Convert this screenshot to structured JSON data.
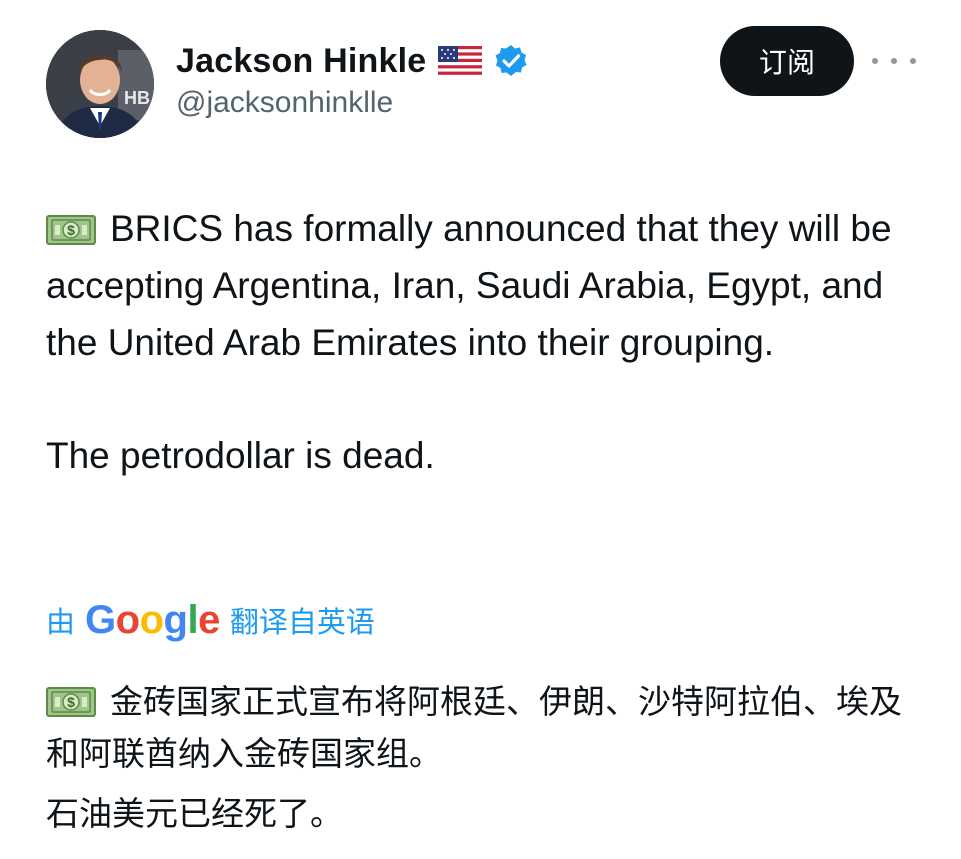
{
  "author": {
    "display_name": "Jackson Hinkle",
    "handle": "@jacksonhinklle",
    "flag_icon": "us-flag-icon",
    "verified_icon": "verified-badge-icon",
    "verified_color": "#1d9bf0"
  },
  "actions": {
    "subscribe_label": "订阅",
    "more_icon": "more-dots-icon"
  },
  "tweet": {
    "emoji_icon": "money-banknote-icon",
    "paragraph_1": "BRICS has formally announced that they will be accepting Argentina, Iran, Saudi Arabia, Egypt, and the United Arab Emirates into their grouping.",
    "paragraph_2": "The petrodollar is dead."
  },
  "translation": {
    "prefix": "由",
    "provider": "Google",
    "suffix": "翻译自英语",
    "paragraph_1": "金砖国家正式宣布将阿根廷、伊朗、沙特阿拉伯、埃及和阿联酋纳入金砖国家组。",
    "paragraph_2": "石油美元已经死了。"
  },
  "colors": {
    "text": "#0f1419",
    "secondary": "#536471",
    "link": "#1d9bf0",
    "button_bg": "#0f1419"
  }
}
